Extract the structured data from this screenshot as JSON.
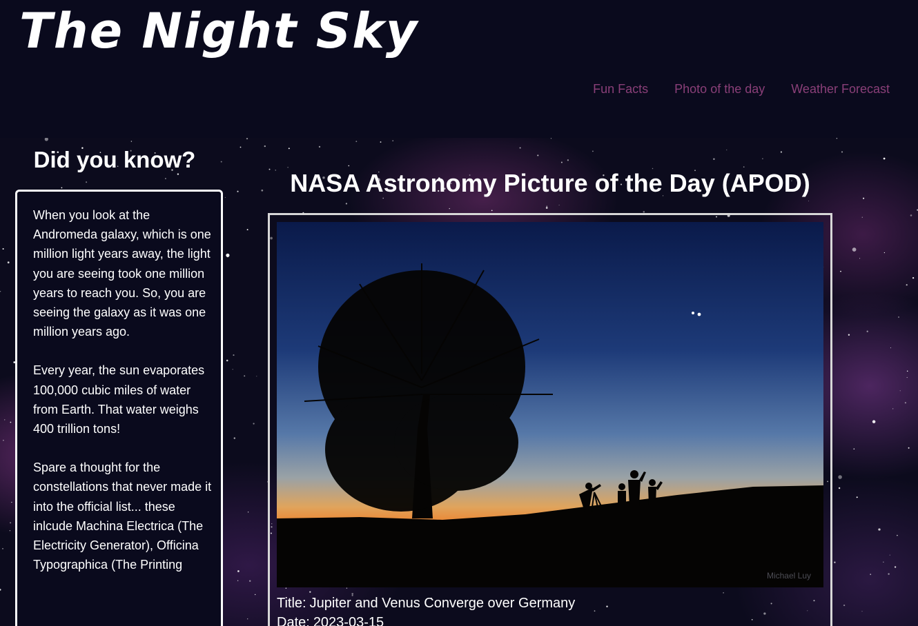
{
  "site": {
    "title": "The Night Sky"
  },
  "nav": {
    "items": [
      {
        "label": "Fun Facts"
      },
      {
        "label": "Photo of the day"
      },
      {
        "label": "Weather Forecast"
      }
    ]
  },
  "facts": {
    "heading": "Did you know?",
    "items": [
      "When you look at the Andromeda galaxy, which is one million light years away, the light you are seeing took one million years to reach you. So, you are seeing the galaxy as it was one million years ago.",
      "Every year, the sun evaporates 100,000 cubic miles of water from Earth. That water weighs 400 trillion tons!",
      "Spare a thought for the constellations that never made it into the official list... these inlcude Machina Electrica (The Electricity Generator), Officina Typographica (The Printing"
    ]
  },
  "apod": {
    "heading": "NASA Astronomy Picture of the Day (APOD)",
    "image_credit": "Michael Luy",
    "title_label": "Title:",
    "title": "Jupiter and Venus Converge over Germany",
    "date_label": "Date:",
    "date": "2023-03-15"
  },
  "colors": {
    "header_bg": "#0a0a1d",
    "nav_link": "#8a3f78",
    "text": "#ffffff"
  }
}
